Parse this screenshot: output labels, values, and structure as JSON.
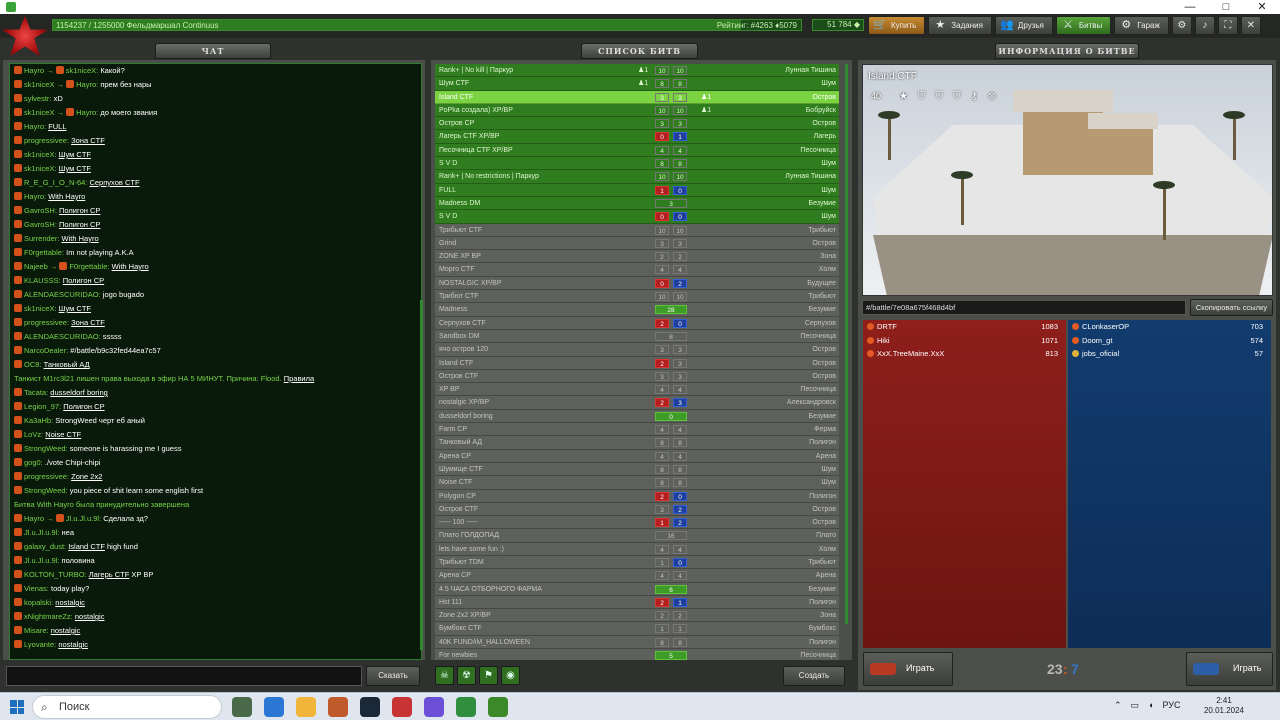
{
  "header": {
    "rank_text": "1154237 / 1255000  Фельдмаршал Continuus",
    "rank_progress": 0.92,
    "rating_text": "Рейтинг: #4263  ♦5079",
    "crystals": "51 784 ◆",
    "nav": [
      {
        "icon": "🛒",
        "label": "Купить"
      },
      {
        "icon": "★",
        "label": "Задания"
      },
      {
        "icon": "👥",
        "label": "Друзья"
      },
      {
        "icon": "⚔",
        "label": "Битвы"
      },
      {
        "icon": "⚙",
        "label": "Гараж"
      }
    ],
    "win_controls": [
      "—",
      "□",
      "✕"
    ]
  },
  "chat": {
    "title": "ЧАТ",
    "send_label": "Сказать",
    "lines": [
      {
        "user": "Hayro →",
        "to": "sk1niceX:",
        "text": "Какой?"
      },
      {
        "user": "sk1niceX →",
        "to": "Hayro:",
        "text": "прем без нары"
      },
      {
        "user": "sylvestr:",
        "to": "",
        "text": "xD"
      },
      {
        "user": "sk1niceX →",
        "to": "Hayro:",
        "text": "до моего звания"
      },
      {
        "user": "Hayro:",
        "to": "",
        "text": "FULL",
        "link": true
      },
      {
        "user": "progressivee:",
        "to": "",
        "text": "Зона CTF",
        "link": true
      },
      {
        "user": "sk1niceX:",
        "to": "",
        "text": "Шум CTF",
        "link": true
      },
      {
        "user": "sk1niceX:",
        "to": "",
        "text": "Шум CTF",
        "link": true
      },
      {
        "user": "R_E_G_I_O_N-64:",
        "to": "",
        "text": "Серпухов CTF",
        "link": true
      },
      {
        "user": "Hayro:",
        "to": "",
        "text": "With Hayro",
        "link": true
      },
      {
        "user": "GavroSH:",
        "to": "",
        "text": "Полигон CP",
        "link": true
      },
      {
        "user": "GavroSH:",
        "to": "",
        "text": "Полигон CP",
        "link": true
      },
      {
        "user": "Surrender:",
        "to": "",
        "text": "With Hayro",
        "link": true
      },
      {
        "user": "F0rgettable:",
        "to": "",
        "text": "Im not playing A.K.A"
      },
      {
        "user": "Najeeb →",
        "to": "F0rgettable:",
        "text": "With Hayro",
        "link": true
      },
      {
        "user": "KLAUSSS:",
        "to": "",
        "text": "Полигон CP",
        "link": true
      },
      {
        "user": "ALENDAESCURIDAO:",
        "to": "",
        "text": "jogo bugado"
      },
      {
        "user": "sk1niceX:",
        "to": "",
        "text": "Шум CTF",
        "link": true
      },
      {
        "user": "progressivee:",
        "to": "",
        "text": "Зона CTF",
        "link": true
      },
      {
        "user": "ALENDAESCURIDAO:",
        "to": "",
        "text": "sssss"
      },
      {
        "user": "NarcoDealer:",
        "to": "",
        "text": "#/battle/b9c32fed44ea7c57"
      },
      {
        "user": "OC8:",
        "to": "",
        "text": "Танковый АД",
        "link": true
      },
      {
        "user": "",
        "to": "",
        "text": "Танкист M1rc3l21 лишен права выхода в эфир НА 5 МИНУТ. Причина: Flood.",
        "system": true,
        "extra": "Правила"
      },
      {
        "user": "Tacata:",
        "to": "",
        "text": "dusseldorf boring",
        "link": true
      },
      {
        "user": "Legion_97:",
        "to": "",
        "text": "Полигон CP",
        "link": true
      },
      {
        "user": "Ka3aHb:",
        "to": "",
        "text": "StrongWeed черт еб аный"
      },
      {
        "user": "LoVz:",
        "to": "",
        "text": "Noise CTF",
        "link": true
      },
      {
        "user": "StrongWeed:",
        "to": "",
        "text": "someone is harassing me I guess"
      },
      {
        "user": "gog0:",
        "to": "",
        "text": "./vote Chipi-chipi"
      },
      {
        "user": "progressivee:",
        "to": "",
        "text": "Zone 2x2",
        "link": true
      },
      {
        "user": "StrongWeed:",
        "to": "",
        "text": "you piece of shit learn some english first"
      },
      {
        "user": "",
        "to": "",
        "text": "Битва With Hayro была принудительно завершена",
        "system": true
      },
      {
        "user": "Hayro →",
        "to": "Jl.u.Jl.u.9l:",
        "text": "Сделала зд?"
      },
      {
        "user": "Jl.u.Jl.u.9l:",
        "to": "",
        "text": "неа"
      },
      {
        "user": "galaxy_dust:",
        "to": "",
        "text": "Island CTF",
        "link": true,
        "extra": "high fund"
      },
      {
        "user": "Jl.u.Jl.u.9l:",
        "to": "",
        "text": "половина"
      },
      {
        "user": "KOLTON_TURBO:",
        "to": "",
        "text": "Лагерь CTF",
        "link": true,
        "extra": "XP BP"
      },
      {
        "user": "Vienas:",
        "to": "",
        "text": "today play?"
      },
      {
        "user": "kopalski:",
        "to": "",
        "text": "nostalgic",
        "link": true
      },
      {
        "user": "xNightmareZz:",
        "to": "",
        "text": "nostalgic",
        "link": true
      },
      {
        "user": "Misare:",
        "to": "",
        "text": "nostalgic",
        "link": true
      },
      {
        "user": "Lyovante:",
        "to": "",
        "text": "nostalgic",
        "link": true
      }
    ]
  },
  "battles": {
    "title": "СПИСОК БИТВ",
    "create_label": "Создать",
    "filters": [
      "☠",
      "☢",
      "⚑",
      "◉"
    ],
    "rows": [
      {
        "name": "Rank+ | No kill | Паркур",
        "map": "Лунная Тишина",
        "l": "10",
        "r": "10",
        "type": "active",
        "ppl": "♟1"
      },
      {
        "name": "Шум CTF",
        "map": "Шум",
        "l": "8",
        "r": "8",
        "type": "active",
        "ppl": "♟1"
      },
      {
        "name": "Island CTF",
        "map": "Остров",
        "l": "3",
        "r": "3",
        "type": "selected",
        "ppl2": "♟1"
      },
      {
        "name": "PoPka создала) XP/BP",
        "map": "Бобруйск",
        "l": "10",
        "r": "10",
        "type": "active",
        "ppl2": "♟1"
      },
      {
        "name": "Остров CP",
        "map": "Остров",
        "l": "3",
        "r": "3",
        "type": "active"
      },
      {
        "name": "Лагерь CTF XP/BP",
        "map": "Лагерь",
        "l": "0",
        "r": "1",
        "type": "active",
        "lc": "red",
        "rc": "blue"
      },
      {
        "name": "Песочница CTF XP/BP",
        "map": "Песочница",
        "l": "4",
        "r": "4",
        "type": "active"
      },
      {
        "name": "S V D",
        "map": "Шум",
        "l": "8",
        "r": "8",
        "type": "active"
      },
      {
        "name": "Rank+ | No restrictions | Паркур",
        "map": "Лунная Тишина",
        "l": "10",
        "r": "10",
        "type": "active"
      },
      {
        "name": "FULL",
        "map": "Шум",
        "l": "1",
        "r": "0",
        "type": "active",
        "lc": "red",
        "rc": "blue"
      },
      {
        "name": "Madness DM",
        "map": "Безумие",
        "dm": "3",
        "type": "active"
      },
      {
        "name": "S V D",
        "map": "Шум",
        "l": "0",
        "r": "0",
        "type": "active",
        "lc": "red",
        "rc": "blue"
      },
      {
        "name": "Трибьют CTF",
        "map": "Трибьют",
        "l": "10",
        "r": "10",
        "type": "full"
      },
      {
        "name": "Grind",
        "map": "Остров",
        "l": "3",
        "r": "3",
        "type": "full"
      },
      {
        "name": "ZONE XP BP",
        "map": "Зона",
        "l": "2",
        "r": "2",
        "type": "full"
      },
      {
        "name": "Морго CTF",
        "map": "Холм",
        "l": "4",
        "r": "4",
        "type": "full"
      },
      {
        "name": "NOSTALGIC XP/BP",
        "map": "Будущее",
        "l": "0",
        "r": "2",
        "type": "full",
        "lc": "red",
        "rc": "blue"
      },
      {
        "name": "Трибют CTF",
        "map": "Трибьют",
        "l": "10",
        "r": "10",
        "type": "full"
      },
      {
        "name": "Madness",
        "map": "Безумие",
        "dm": "28",
        "type": "full",
        "dmc": "green"
      },
      {
        "name": "Серпухов CTF",
        "map": "Серпухов",
        "l": "2",
        "r": "0",
        "type": "full",
        "lc": "red",
        "rc": "blue"
      },
      {
        "name": "Sandbox DM",
        "map": "Песочница",
        "dm": "8",
        "type": "full"
      },
      {
        "name": "ячо остров 120",
        "map": "Остров",
        "l": "3",
        "r": "3",
        "type": "full"
      },
      {
        "name": "Island CTF",
        "map": "Остров",
        "l": "2",
        "r": "3",
        "type": "full",
        "lc": "red"
      },
      {
        "name": "Остров CTF",
        "map": "Остров",
        "l": "3",
        "r": "3",
        "type": "full"
      },
      {
        "name": "XP BP",
        "map": "Песочница",
        "l": "4",
        "r": "4",
        "type": "full"
      },
      {
        "name": "nostalgic XP/BP",
        "map": "Александровск",
        "l": "2",
        "r": "3",
        "type": "full",
        "lc": "red",
        "rc": "blue"
      },
      {
        "name": "dusseldorf boring",
        "map": "Безумие",
        "dm": "0",
        "type": "full",
        "dmc": "green"
      },
      {
        "name": "Farm CP",
        "map": "Ферма",
        "l": "4",
        "r": "4",
        "type": "full"
      },
      {
        "name": "Танковый АД",
        "map": "Полигон",
        "l": "8",
        "r": "8",
        "type": "full"
      },
      {
        "name": "Арена CP",
        "map": "Арена",
        "l": "4",
        "r": "4",
        "type": "full"
      },
      {
        "name": "Шумище CTF",
        "map": "Шум",
        "l": "8",
        "r": "8",
        "type": "full"
      },
      {
        "name": "Noise CTF",
        "map": "Шум",
        "l": "8",
        "r": "8",
        "type": "full"
      },
      {
        "name": "Polygon CP",
        "map": "Полигон",
        "l": "2",
        "r": "0",
        "type": "full",
        "lc": "red",
        "rc": "blue"
      },
      {
        "name": "Остров CTF",
        "map": "Остров",
        "l": "3",
        "r": "2",
        "type": "full",
        "rc": "blue"
      },
      {
        "name": "----- 100 -----",
        "map": "Остров",
        "l": "1",
        "r": "2",
        "type": "full",
        "lc": "red",
        "rc": "blue"
      },
      {
        "name": "Плато ГОЛДОПАД",
        "map": "Плато",
        "dm": "16",
        "type": "full"
      },
      {
        "name": "lets have some fun :)",
        "map": "Холм",
        "l": "4",
        "r": "4",
        "type": "full"
      },
      {
        "name": "Трибьют TDM",
        "map": "Трибьют",
        "l": "1",
        "r": "0",
        "type": "full",
        "rc": "blue"
      },
      {
        "name": "Арена CP",
        "map": "Арена",
        "l": "4",
        "r": "4",
        "type": "full"
      },
      {
        "name": "4.5 ЧАСА ОТБОРНОГО ФАРМА",
        "map": "Безумие",
        "dm": "6",
        "type": "full",
        "dmc": "green"
      },
      {
        "name": "Hst 111",
        "map": "Полигон",
        "l": "2",
        "r": "1",
        "type": "full",
        "lc": "red",
        "rc": "blue"
      },
      {
        "name": "Zone 2x2 XP/BP",
        "map": "Зона",
        "l": "2",
        "r": "2",
        "type": "full"
      },
      {
        "name": "Бумбокс CTF",
        "map": "Бумбокс",
        "l": "1",
        "r": "1",
        "type": "full"
      },
      {
        "name": "40K FUND/iM_HALLOWEEN",
        "map": "Полигон",
        "l": "8",
        "r": "8",
        "type": "full"
      },
      {
        "name": "For newbies",
        "map": "Песочница",
        "dm": "5",
        "type": "full",
        "dmc": "green"
      }
    ]
  },
  "info": {
    "title": "ИНФОРМАЦИЯ О БИТВЕ",
    "map_name": "Island CTF",
    "players_count": "40",
    "icons": [
      "★",
      "⛉",
      "⛉",
      "⛉",
      "⚷",
      "⊗"
    ],
    "link": "#/battle/7e08a675f468d4bf",
    "copy_label": "Скопировать ссылку",
    "red_team": [
      {
        "name": "DRTF",
        "score": "1083"
      },
      {
        "name": "Hiki",
        "score": "1071"
      },
      {
        "name": "XxX.TreeMaine.XxX",
        "score": "813"
      }
    ],
    "blue_team": [
      {
        "name": "CLonkaserOP",
        "score": "703"
      },
      {
        "name": "Doom_gt",
        "score": "574"
      },
      {
        "name": "jobs_oficial",
        "score": "57"
      }
    ],
    "play_label": "Играть",
    "score_red": "23",
    "score_sep": ":",
    "score_blue": "7"
  },
  "taskbar": {
    "search_placeholder": "Поиск",
    "lang": "РУС",
    "time": "2:41",
    "date": "20.01.2024",
    "app_colors": [
      "#4a6a4a",
      "#2b78d4",
      "#f2b53b",
      "#c05a2a",
      "#1b2838",
      "#c83434",
      "#6b4fd6",
      "#2f8f3f",
      "#3a8a2a"
    ]
  }
}
